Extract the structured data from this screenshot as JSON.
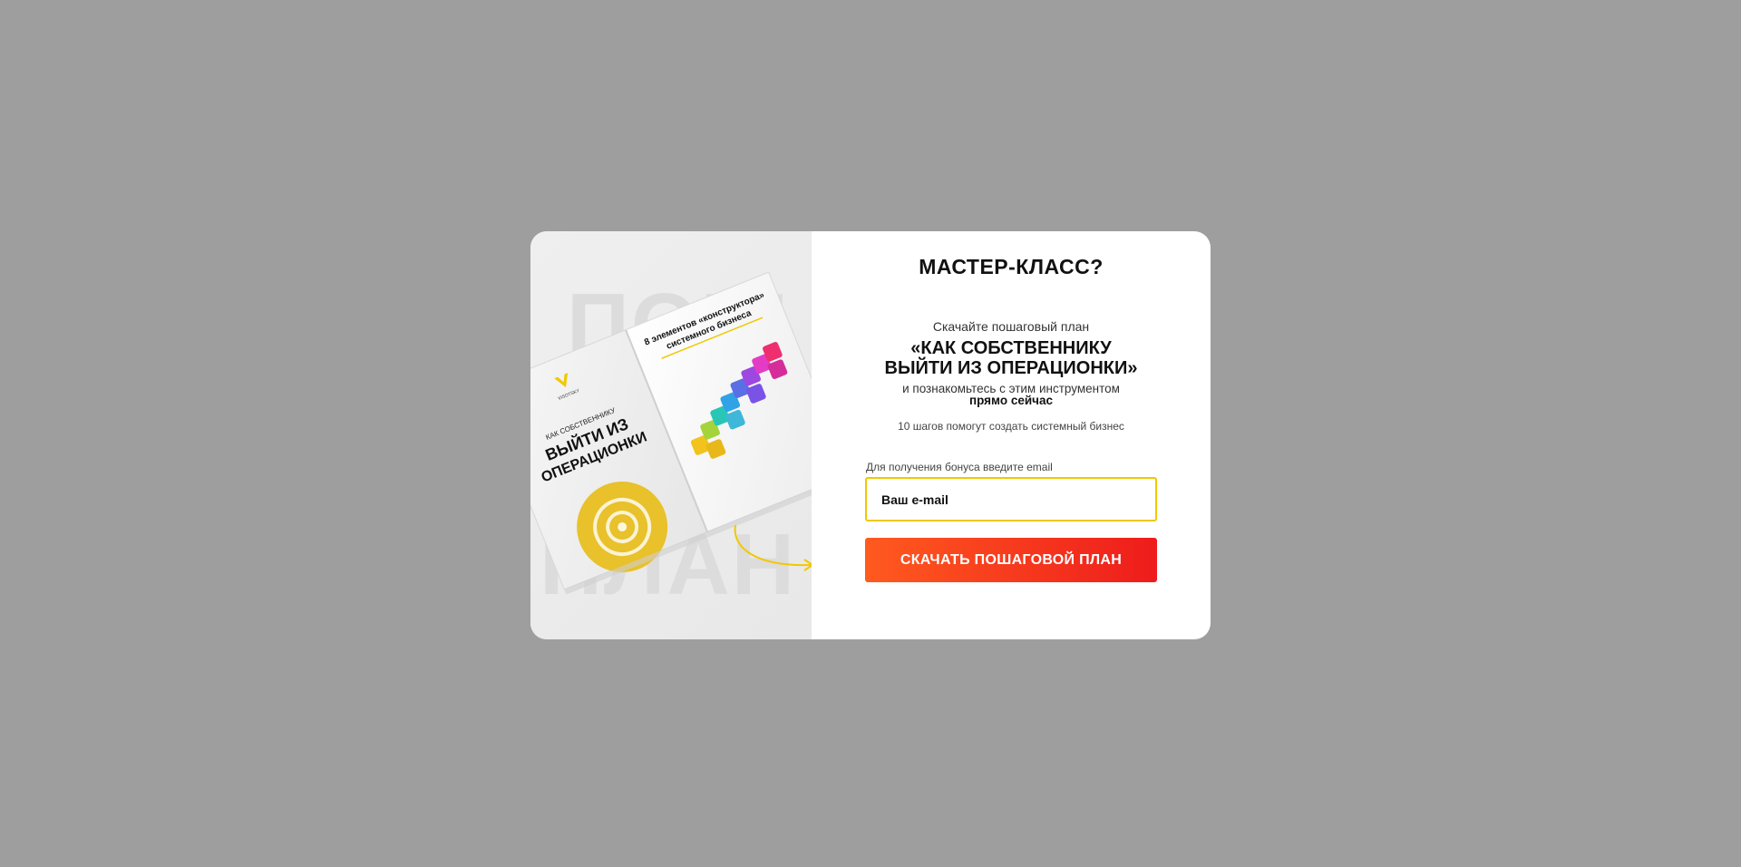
{
  "modal": {
    "title": "МАСТЕР-КЛАСС?",
    "subtitle": "Скачайте пошаговый план",
    "headline_line1": "«КАК СОБСТВЕННИКУ",
    "headline_line2": "ВЫЙТИ ИЗ ОПЕРАЦИОНКИ»",
    "desc_line1": "и познакомьтесь с этим инструментом",
    "desc_line2": "прямо сейчас",
    "steps_text": "10 шагов помогут создать системный бизнес",
    "email_label": "Для получения бонуса введите email",
    "email_placeholder": "Ваш e-mail",
    "email_value": "",
    "button_label": "СКАЧАТЬ ПОШАГОВОЙ ПЛАН"
  },
  "book": {
    "bg_word_top": "ПОШ",
    "bg_word_bottom": "ПЛАН",
    "brand": "VISOTSKY",
    "cover_small": "КАК СОБСТВЕННИКУ",
    "cover_big_1": "ВЫЙТИ ИЗ",
    "cover_big_2": "ОПЕРАЦИОНКИ",
    "page_heading_1": "8 элементов «конструктора»",
    "page_heading_2": "системного бизнеса"
  },
  "colors": {
    "overlay": "#9e9e9e",
    "accent_yellow": "#f0c800",
    "button_start": "#ff5a1f",
    "button_end": "#ee1c1c"
  }
}
